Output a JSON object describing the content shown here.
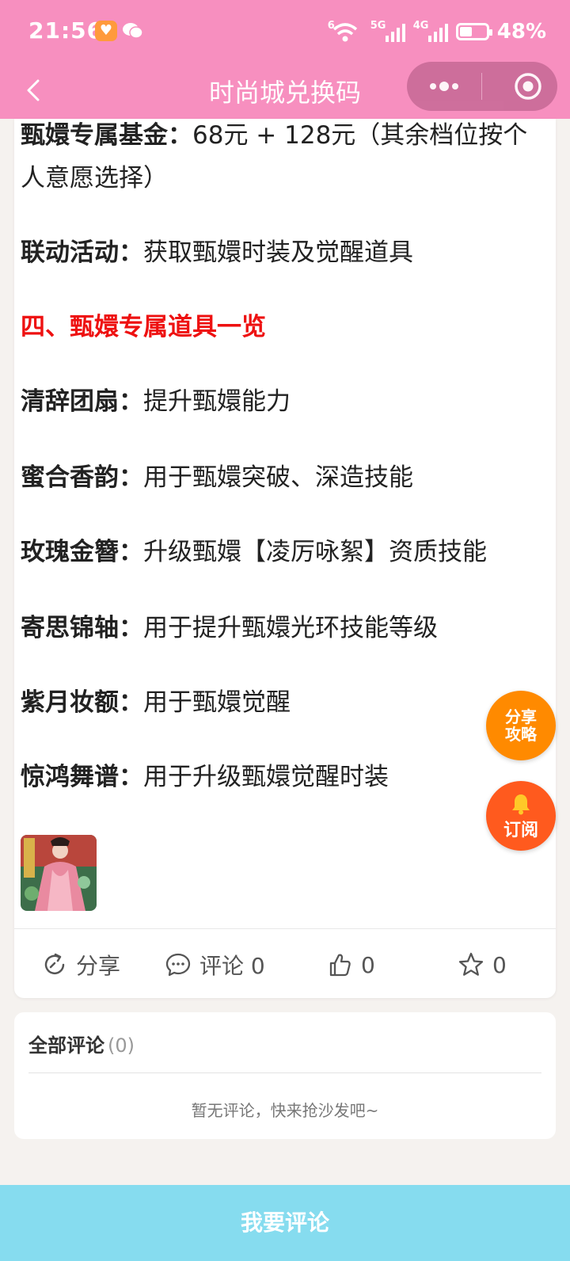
{
  "status_bar": {
    "time": "21:56",
    "signal1_label": "5G",
    "signal2_label": "4G",
    "wifi_label": "6",
    "battery_percent": "48%",
    "battery_level": 0.48
  },
  "nav": {
    "title": "时尚城兑换码"
  },
  "article": {
    "fund_label": "甄嬛专属基金：",
    "fund_text": "68元 + 128元（其余档位按个人意愿选择）",
    "event_label": "联动活动：",
    "event_text": "获取甄嬛时装及觉醒道具",
    "section_heading": "四、甄嬛专属道具一览",
    "items": [
      {
        "name": "清辞团扇：",
        "desc": "提升甄嬛能力"
      },
      {
        "name": "蜜合香韵：",
        "desc": "用于甄嬛突破、深造技能"
      },
      {
        "name": "玫瑰金簪：",
        "desc": "升级甄嬛【凌厉咏絮】资质技能"
      },
      {
        "name": "寄思锦轴：",
        "desc": "用于提升甄嬛光环技能等级"
      },
      {
        "name": "紫月妆额：",
        "desc": "用于甄嬛觉醒"
      },
      {
        "name": "惊鸿舞谱：",
        "desc": "用于升级甄嬛觉醒时装"
      }
    ]
  },
  "actions": {
    "share_label": "分享",
    "comment_label": "评论 0",
    "like_count": "0",
    "favorite_count": "0"
  },
  "comments": {
    "title": "全部评论",
    "count": "(0)",
    "empty_text": "暂无评论，快来抢沙发吧~"
  },
  "floating": {
    "share_line1": "分享",
    "share_line2": "攻略",
    "subscribe": "订阅"
  },
  "bottom": {
    "comment_button": "我要评论"
  },
  "colors": {
    "header": "#f78fbf",
    "accent_red": "#e11111",
    "bottom_bar": "#86dcef",
    "share_fab": "#ff8a00",
    "subscribe_fab": "#ff5a1e"
  }
}
